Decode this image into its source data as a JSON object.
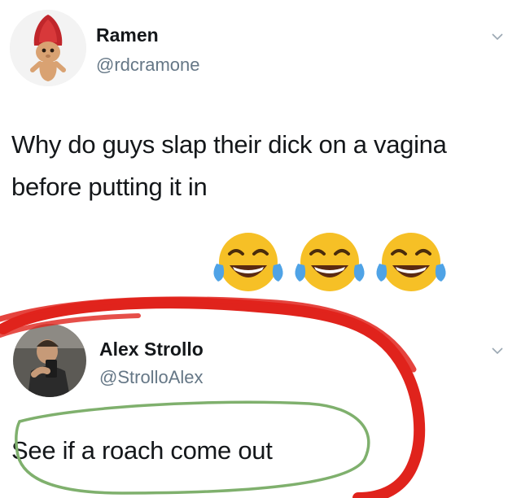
{
  "tweet1": {
    "display_name": "Ramen",
    "handle": "@rdcramone",
    "text": "Why do guys slap their dick on a vagina before putting it in",
    "emojis": [
      "face-with-tears-of-joy",
      "face-with-tears-of-joy",
      "face-with-tears-of-joy"
    ],
    "avatar_icon": "troll-doll-avatar"
  },
  "tweet2": {
    "display_name": "Alex Strollo",
    "handle": "@StrolloAlex",
    "text": "See if a roach come out",
    "avatar_icon": "person-photo-avatar"
  },
  "colors": {
    "handle": "#657786",
    "text": "#14171a",
    "red_marker": "#e0231c",
    "green_marker": "#7fb06d"
  }
}
